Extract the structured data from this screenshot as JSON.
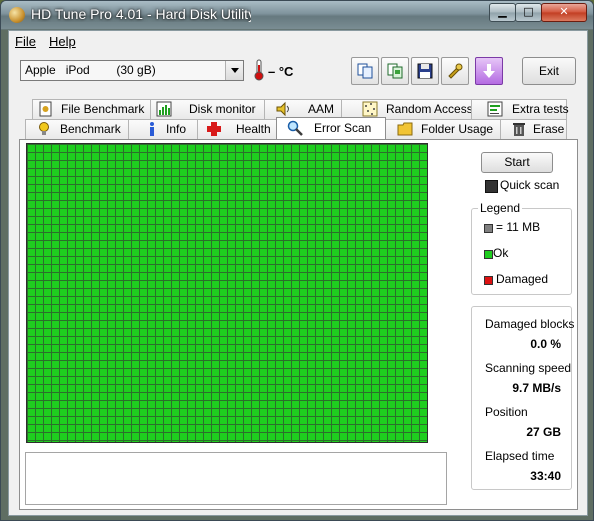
{
  "window": {
    "title": "HD Tune Pro 4.01 - Hard Disk Utility"
  },
  "menu": {
    "file": "File",
    "help": "Help"
  },
  "toolbar": {
    "drive": "Apple   iPod        (30 gB)",
    "temperature": "– °C",
    "exit": "Exit"
  },
  "tabs_row1": [
    {
      "label": "File Benchmark",
      "icon": "benchmark-file-icon"
    },
    {
      "label": "Disk monitor",
      "icon": "disk-monitor-icon"
    },
    {
      "label": "AAM",
      "icon": "speaker-icon"
    },
    {
      "label": "Random Access",
      "icon": "random-access-icon"
    },
    {
      "label": "Extra tests",
      "icon": "extra-tests-icon"
    }
  ],
  "tabs_row2": [
    {
      "label": "Benchmark",
      "icon": "bulb-icon"
    },
    {
      "label": "Info",
      "icon": "info-icon"
    },
    {
      "label": "Health",
      "icon": "health-cross-icon"
    },
    {
      "label": "Error Scan",
      "icon": "magnifier-icon",
      "active": true
    },
    {
      "label": "Folder Usage",
      "icon": "folder-icon"
    },
    {
      "label": "Erase",
      "icon": "trash-icon"
    }
  ],
  "error_scan": {
    "start": "Start",
    "quick_scan": "Quick scan",
    "legend": {
      "title": "Legend",
      "block": "= 11 MB",
      "ok": "Ok",
      "damaged": "Damaged"
    },
    "stats": {
      "damaged_blocks_label": "Damaged blocks",
      "damaged_blocks_value": "0.0 %",
      "scanning_speed_label": "Scanning speed",
      "scanning_speed_value": "9.7 MB/s",
      "position_label": "Position",
      "position_value": "27 GB",
      "elapsed_label": "Elapsed time",
      "elapsed_value": "33:40"
    }
  },
  "colors": {
    "ok": "#1fce1f",
    "damaged": "#dd1111",
    "block": "#808080"
  }
}
